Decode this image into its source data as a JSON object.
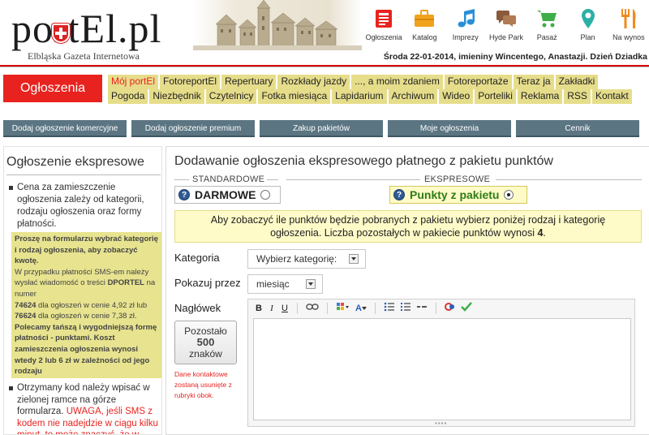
{
  "site": {
    "logo_text": "portEl.pl",
    "logo_subtitle": "Elbląska Gazeta Internetowa",
    "dateline": "Środa 22-01-2014, imieniny Wincentego, Anastazji. Dzień Dziadka"
  },
  "topnav": [
    {
      "label": "Ogłoszenia",
      "icon": "newspaper-icon",
      "color": "#e8231f"
    },
    {
      "label": "Katalog",
      "icon": "briefcase-icon",
      "color": "#f0a21c"
    },
    {
      "label": "Imprezy",
      "icon": "music-note-icon",
      "color": "#2a8fd6"
    },
    {
      "label": "Hyde Park",
      "icon": "speech-bubbles-icon",
      "color": "#8a5a3c"
    },
    {
      "label": "Pasaż",
      "icon": "shopping-cart-icon",
      "color": "#3fae49"
    },
    {
      "label": "Plan",
      "icon": "map-pin-icon",
      "color": "#2bb0a6"
    },
    {
      "label": "Na wynos",
      "icon": "fork-knife-icon",
      "color": "#f08a1c"
    }
  ],
  "section_title": "Ogłoszenia",
  "nav_row1": [
    "Mój portEl",
    "FotoreportEl",
    "Repertuary",
    "Rozkłady jazdy",
    "..., a moim zdaniem",
    "Fotoreportaże",
    "Teraz ja",
    "Zakładki"
  ],
  "nav_row2": [
    "Pogoda",
    "Niezbędnik",
    "Czytelnicy",
    "Fotka miesiąca",
    "Lapidarium",
    "Archiwum",
    "Wideo",
    "Porteliki",
    "Reklama",
    "RSS",
    "Kontakt"
  ],
  "actions": [
    "Dodaj ogłoszenie komercyjne",
    "Dodaj ogłoszenie premium",
    "Zakup pakietów",
    "Moje ogłoszenia",
    "Cennik"
  ],
  "sidebar": {
    "title": "Ogłoszenie ekspresowe",
    "bullet1": "Cena za zamieszczenie ogłoszenia zależy od kategorii, rodzaju ogłoszenia oraz formy płatności.",
    "info": {
      "p1": "Proszę na formularzu wybrać kategorię i rodzaj ogłoszenia, aby zobaczyć kwotę.",
      "p2a": "W przypadku płatności SMS-em należy wysłać wiadomość o treści ",
      "p2b": "DPORTEL",
      "p2c": " na numer",
      "n1": "74624",
      "n1t": " dla ogłoszeń w cenie 4,92 zł lub",
      "n2": "76624",
      "n2t": " dla ogłoszeń w cenie 7,38 zł.",
      "p3": "Polecamy tańszą i wygodniejszą formę płatności - punktami. Koszt zamieszczenia ogłoszenia wynosi wtedy 2 lub 6 zł w zależności od jego rodzaju"
    },
    "bullet2a": "Otrzymany kod należy wpisać w zielonej ramce na górze formularza. ",
    "bullet2b": "UWAGA, jeśli SMS z kodem nie nadejdzie w ciągu kilku minut, to może znaczyć, że w telefonie nie ma"
  },
  "main": {
    "title": "Dodawanie ogłoszenia ekspresowego płatnego z pakietu punktów",
    "standard_label": "STANDARDOWE",
    "express_label": "EKSPRESOWE",
    "option_free": "DARMOWE",
    "option_points": "Punkty z pakietu",
    "selected_option": "option_points",
    "notice_text": "Aby zobaczyć ile punktów będzie pobranych z pakietu wybierz poniżej rodzaj i kategorię ogłoszenia. Liczba pozostałych w pakiecie punktów wynosi ",
    "notice_points": "4",
    "notice_end": ".",
    "category_label": "Kategoria",
    "category_value": "Wybierz kategorię:",
    "show_label": "Pokazuj przez",
    "show_value": "miesiąc",
    "heading_label": "Nagłówek",
    "counter_top": "Pozostało",
    "counter_num": "500",
    "counter_bottom": "znaków",
    "contact_note": "Dane kontaktowe zostaną usunięte z rubryki obok."
  },
  "toolbar": {
    "bold": "B",
    "italic": "I",
    "underline": "U"
  },
  "colors": {
    "brand_red": "#e8231f",
    "nav_yellow": "#e6dd8b",
    "action_button": "#5b7582",
    "points_green": "#2e7d16"
  }
}
